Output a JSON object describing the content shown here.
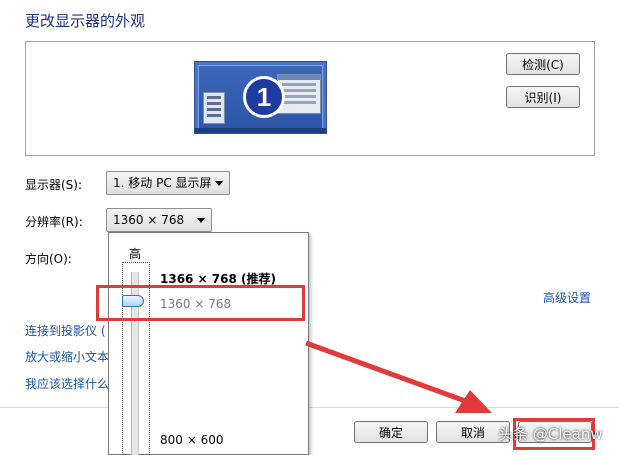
{
  "header": {
    "title": "更改显示器的外观"
  },
  "preview": {
    "monitor_number": "1"
  },
  "buttons": {
    "detect": "检测(C)",
    "identify": "识别(I)",
    "ok": "确定",
    "cancel": "取消"
  },
  "form": {
    "display_label": "显示器(S):",
    "display_value": "1. 移动 PC 显示屏",
    "resolution_label": "分辨率(R):",
    "resolution_value": "1360 × 768",
    "orientation_label": "方向(O):"
  },
  "resolution_dropdown": {
    "high_label": "高",
    "options": [
      "1366 × 768 (推荐)",
      "1360 × 768",
      "800 × 600"
    ],
    "selected": "1360 × 768"
  },
  "links": {
    "advanced": "高级设置",
    "projector": "连接到投影仪 (",
    "text_size": "放大或缩小文本",
    "which_settings": "我应该选择什么"
  },
  "watermark": "头条 @Cleanw",
  "colors": {
    "highlight_box": "#e23a3a",
    "arrow": "#e23a3a",
    "link": "#1a55a8",
    "title": "#1e3287"
  }
}
